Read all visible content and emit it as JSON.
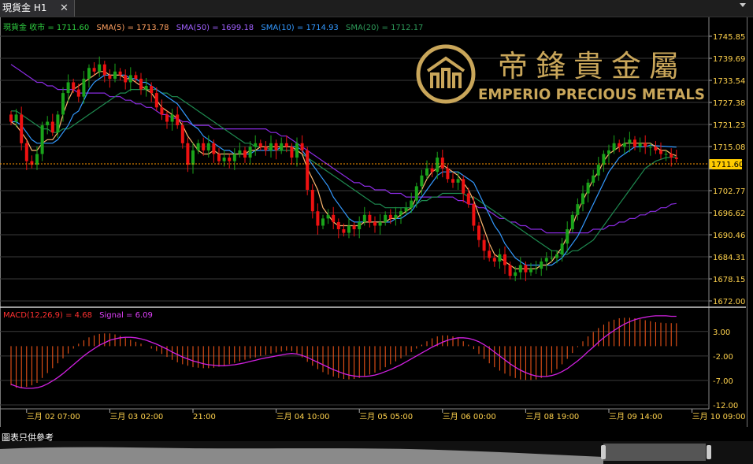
{
  "window": {
    "tab_title": "現貨金 H1",
    "close_glyph": "✕"
  },
  "legend": {
    "price": "現貨金 收市 = 1711.60",
    "sma5": "SMA(5) = 1713.78",
    "sma50": "SMA(50) = 1699.18",
    "sma10": "SMA(10) = 1714.93",
    "sma20": "SMA(20) = 1712.17"
  },
  "macd_legend": {
    "macd": "MACD(12,26,9) = 4.68",
    "signal": "Signal = 6.09"
  },
  "logo": {
    "chinese": "帝鋒貴金屬",
    "english": "EMPERIO PRECIOUS METALS"
  },
  "current_price_label": "1711.60",
  "footer_text": "圖表只供參考",
  "colors": {
    "up": "#1aa31a",
    "down": "#ee1111",
    "sma5": "#ffb870",
    "sma10": "#3399ff",
    "sma20": "#1e8a50",
    "sma50": "#8a2be2",
    "macd_hist": "#ff5a1a",
    "signal": "#d020e0",
    "gold": "#c9a65a",
    "axis_text": "#ffd24d",
    "grid": "#3a3a3a"
  },
  "chart_data": {
    "type": "candlestick",
    "instrument": "現貨金",
    "timeframe": "H1",
    "price_axis": {
      "ticks": [
        1745.85,
        1739.69,
        1733.54,
        1727.38,
        1721.23,
        1715.08,
        1708.92,
        1702.77,
        1696.62,
        1690.46,
        1684.31,
        1678.15,
        1672.0
      ],
      "tick_labels": [
        "1745.85",
        "1739.69",
        "1733.54",
        "1727.38",
        "1721.23",
        "1715.08",
        "",
        "1702.77",
        "1696.62",
        "1690.46",
        "1684.31",
        "1678.15",
        "1672.00"
      ],
      "ylim": [
        1672.0,
        1745.85
      ]
    },
    "macd_axis": {
      "ticks": [
        3.0,
        -2.0,
        -7.0,
        -12.0
      ],
      "tick_labels": [
        "3.00",
        "-2.00",
        "-7.00",
        "-12.00"
      ],
      "ylim": [
        -12.0,
        6.5
      ]
    },
    "x_ticks": [
      {
        "index": 3,
        "label": "三月 02 07:00"
      },
      {
        "index": 19,
        "label": "三月 03 02:00"
      },
      {
        "index": 35,
        "label": "21:00"
      },
      {
        "index": 51,
        "label": "三月 04 10:00"
      },
      {
        "index": 67,
        "label": "三月 05 05:00"
      },
      {
        "index": 83,
        "label": "三月 06 00:00"
      },
      {
        "index": 99,
        "label": "三月 08 19:00"
      },
      {
        "index": 115,
        "label": "三月 09 14:00"
      },
      {
        "index": 131,
        "label": "三月 10 09:00"
      }
    ],
    "current_price": 1711.6,
    "close": [
      1722,
      1724,
      1716,
      1711,
      1710,
      1713,
      1721,
      1722,
      1719,
      1724,
      1730,
      1733,
      1731,
      1729,
      1734,
      1737,
      1736,
      1738,
      1735,
      1734,
      1736,
      1735,
      1733,
      1735,
      1734,
      1731,
      1732,
      1730,
      1726,
      1724,
      1722,
      1724,
      1721,
      1716,
      1710,
      1714,
      1716,
      1714,
      1716,
      1713,
      1711,
      1712,
      1711,
      1713,
      1714,
      1712,
      1715,
      1716,
      1715,
      1714,
      1716,
      1714,
      1716,
      1715,
      1712,
      1716,
      1714,
      1703,
      1697,
      1693,
      1695,
      1696,
      1694,
      1692,
      1691,
      1693,
      1692,
      1694,
      1696,
      1694,
      1693,
      1694,
      1696,
      1695,
      1696,
      1697,
      1698,
      1700,
      1704,
      1707,
      1709,
      1708,
      1712,
      1709,
      1706,
      1705,
      1706,
      1702,
      1699,
      1693,
      1689,
      1686,
      1684,
      1683,
      1685,
      1682,
      1679,
      1680,
      1682,
      1680,
      1681,
      1681,
      1683,
      1684,
      1684,
      1685,
      1688,
      1692,
      1696,
      1699,
      1702,
      1705,
      1707,
      1710,
      1713,
      1714,
      1716,
      1715,
      1716,
      1717,
      1715,
      1716,
      1715,
      1715,
      1714,
      1713,
      1713,
      1712,
      1711.6
    ],
    "sma5": [
      1722,
      1721,
      1719,
      1717,
      1714,
      1714,
      1716,
      1717,
      1717,
      1719,
      1724,
      1728,
      1731,
      1732,
      1733,
      1734,
      1735,
      1736,
      1736,
      1735,
      1735,
      1735,
      1734,
      1734,
      1733,
      1732,
      1731,
      1730,
      1728,
      1726,
      1725,
      1724,
      1723,
      1721,
      1718,
      1716,
      1714,
      1713,
      1713,
      1714,
      1713,
      1713,
      1713,
      1713,
      1713,
      1713,
      1714,
      1714,
      1715,
      1715,
      1715,
      1715,
      1715,
      1715,
      1715,
      1714,
      1713,
      1709,
      1706,
      1703,
      1698,
      1696,
      1694,
      1693,
      1693,
      1693,
      1693,
      1693,
      1694,
      1694,
      1694,
      1694,
      1694,
      1695,
      1695,
      1696,
      1697,
      1698,
      1701,
      1703,
      1706,
      1708,
      1709,
      1710,
      1709,
      1708,
      1707,
      1705,
      1703,
      1700,
      1696,
      1692,
      1688,
      1685,
      1684,
      1683,
      1682,
      1681,
      1681,
      1681,
      1681,
      1681,
      1682,
      1682,
      1683,
      1685,
      1687,
      1690,
      1693,
      1697,
      1700,
      1703,
      1706,
      1708,
      1711,
      1713,
      1714,
      1715,
      1716,
      1716,
      1716,
      1716,
      1716,
      1716,
      1715,
      1714,
      1714,
      1713,
      1712.5
    ],
    "sma10": [
      1722,
      1722,
      1721,
      1719,
      1717,
      1716,
      1716,
      1716,
      1716,
      1717,
      1719,
      1721,
      1724,
      1725,
      1728,
      1731,
      1733,
      1734,
      1735,
      1735,
      1735,
      1735,
      1735,
      1734,
      1734,
      1733,
      1733,
      1732,
      1731,
      1730,
      1729,
      1728,
      1727,
      1725,
      1723,
      1721,
      1720,
      1718,
      1717,
      1716,
      1715,
      1714,
      1714,
      1713,
      1713,
      1713,
      1713,
      1714,
      1714,
      1714,
      1714,
      1714,
      1715,
      1715,
      1715,
      1715,
      1714,
      1712,
      1710,
      1708,
      1706,
      1704,
      1701,
      1699,
      1697,
      1695,
      1694,
      1694,
      1694,
      1694,
      1694,
      1694,
      1694,
      1694,
      1695,
      1695,
      1696,
      1697,
      1699,
      1701,
      1703,
      1705,
      1707,
      1708,
      1708,
      1708,
      1708,
      1707,
      1706,
      1705,
      1702,
      1699,
      1696,
      1693,
      1691,
      1688,
      1686,
      1684,
      1683,
      1682,
      1682,
      1682,
      1682,
      1682,
      1682,
      1683,
      1684,
      1686,
      1688,
      1690,
      1693,
      1696,
      1699,
      1702,
      1705,
      1708,
      1710,
      1712,
      1713,
      1714,
      1715,
      1715,
      1715,
      1715.5,
      1715.3,
      1715.2,
      1715.1,
      1715,
      1714.9
    ],
    "sma20": [
      1725,
      1725,
      1724,
      1723,
      1722,
      1721,
      1720,
      1720,
      1719,
      1719,
      1720,
      1720,
      1721,
      1722,
      1723,
      1724,
      1725,
      1726,
      1727,
      1728,
      1729,
      1730,
      1730,
      1731,
      1731,
      1731,
      1731,
      1731,
      1731,
      1730,
      1730,
      1729,
      1729,
      1728,
      1727,
      1726,
      1725,
      1724,
      1723,
      1722,
      1721,
      1720,
      1719,
      1718,
      1717,
      1716,
      1716,
      1715,
      1715,
      1715,
      1714,
      1714,
      1714,
      1714,
      1714,
      1714,
      1713,
      1712,
      1711,
      1710,
      1709,
      1708,
      1707,
      1706,
      1705,
      1704,
      1703,
      1702,
      1701,
      1700,
      1699,
      1699,
      1698,
      1698,
      1698,
      1698,
      1698,
      1698,
      1699,
      1700,
      1700,
      1701,
      1701,
      1702,
      1702,
      1702,
      1702,
      1702,
      1701,
      1701,
      1700,
      1699,
      1698,
      1697,
      1696,
      1695,
      1694,
      1693,
      1692,
      1691,
      1690,
      1689,
      1688,
      1687,
      1686,
      1686,
      1685,
      1685,
      1686,
      1686,
      1687,
      1688,
      1689,
      1691,
      1693,
      1695,
      1697,
      1699,
      1701,
      1703,
      1705,
      1707,
      1709,
      1710,
      1711,
      1711.5,
      1712,
      1712.1,
      1712.2
    ],
    "sma50": [
      1738,
      1737,
      1736,
      1735,
      1734,
      1733,
      1733,
      1732,
      1732,
      1731,
      1731,
      1731,
      1731,
      1730,
      1730,
      1730,
      1730,
      1730,
      1730,
      1729,
      1729,
      1729,
      1728,
      1728,
      1727,
      1727,
      1726,
      1726,
      1725,
      1724,
      1724,
      1723,
      1723,
      1722,
      1722,
      1721,
      1721,
      1721,
      1721,
      1720,
      1720,
      1720,
      1720,
      1720,
      1720,
      1720,
      1720,
      1720,
      1720,
      1720,
      1719,
      1719,
      1718,
      1718,
      1717,
      1716,
      1715,
      1714,
      1713,
      1712,
      1711,
      1710,
      1709,
      1708,
      1707,
      1706,
      1705,
      1705,
      1704,
      1704,
      1703,
      1703,
      1703,
      1702,
      1702,
      1702,
      1701,
      1701,
      1701,
      1701,
      1701,
      1701,
      1701,
      1701,
      1701,
      1701,
      1700,
      1700,
      1699,
      1699,
      1698,
      1698,
      1697,
      1696,
      1695,
      1695,
      1694,
      1694,
      1693,
      1693,
      1692,
      1692,
      1692,
      1691,
      1691,
      1691,
      1691,
      1691,
      1691,
      1691,
      1691,
      1691,
      1692,
      1692,
      1692,
      1693,
      1693,
      1694,
      1694,
      1695,
      1695,
      1696,
      1696,
      1697,
      1697,
      1698,
      1698,
      1699,
      1699.18
    ],
    "macd_hist": [
      -8,
      -8.5,
      -8.5,
      -8.3,
      -8,
      -7.5,
      -6.5,
      -5.5,
      -4.5,
      -3.5,
      -2.5,
      -1.5,
      -0.5,
      0.5,
      1.2,
      1.8,
      2.2,
      2.5,
      2.6,
      2.6,
      2.4,
      2.1,
      1.7,
      1.3,
      0.9,
      0.5,
      0,
      -0.5,
      -1,
      -1.6,
      -2.2,
      -2.8,
      -3.3,
      -3.7,
      -4,
      -4.3,
      -4.4,
      -4.5,
      -4.5,
      -4.4,
      -4.2,
      -4,
      -3.7,
      -3.4,
      -3.1,
      -2.8,
      -2.5,
      -2.3,
      -2,
      -1.8,
      -1.5,
      -1.3,
      -1.1,
      -0.9,
      -1,
      -1.5,
      -2.3,
      -3.2,
      -4,
      -4.7,
      -5.3,
      -5.8,
      -6.2,
      -6.5,
      -6.7,
      -6.8,
      -6.7,
      -6.5,
      -6.2,
      -5.8,
      -5.4,
      -4.9,
      -4.3,
      -3.7,
      -3.1,
      -2.5,
      -1.9,
      -1.2,
      -0.5,
      0.3,
      1,
      1.6,
      2,
      2.2,
      2.2,
      2,
      1.6,
      1,
      0.3,
      -0.6,
      -1.6,
      -2.6,
      -3.5,
      -4.3,
      -5,
      -5.6,
      -6.1,
      -6.5,
      -6.8,
      -6.9,
      -6.9,
      -6.8,
      -6.5,
      -6.1,
      -5.5,
      -4.7,
      -3.7,
      -2.6,
      -1.4,
      -0.2,
      1,
      2,
      2.9,
      3.7,
      4.4,
      5,
      5.4,
      5.7,
      5.8,
      5.8,
      5.7,
      5.5,
      5.3,
      5.1,
      4.9,
      4.8,
      4.7,
      4.7,
      4.68
    ],
    "signal": [
      -7.8,
      -8.2,
      -8.5,
      -8.6,
      -8.6,
      -8.5,
      -8.2,
      -7.7,
      -7.1,
      -6.4,
      -5.6,
      -4.7,
      -3.8,
      -2.9,
      -2,
      -1.2,
      -0.5,
      0.2,
      0.7,
      1.2,
      1.5,
      1.7,
      1.8,
      1.8,
      1.7,
      1.5,
      1.2,
      0.8,
      0.4,
      -0.1,
      -0.6,
      -1.2,
      -1.7,
      -2.2,
      -2.6,
      -3,
      -3.3,
      -3.6,
      -3.8,
      -3.9,
      -4,
      -4,
      -3.9,
      -3.8,
      -3.6,
      -3.4,
      -3.1,
      -2.9,
      -2.6,
      -2.4,
      -2.2,
      -2,
      -1.8,
      -1.6,
      -1.5,
      -1.6,
      -1.9,
      -2.3,
      -2.8,
      -3.3,
      -3.8,
      -4.3,
      -4.8,
      -5.2,
      -5.6,
      -5.9,
      -6.1,
      -6.2,
      -6.2,
      -6.1,
      -5.9,
      -5.6,
      -5.2,
      -4.8,
      -4.3,
      -3.8,
      -3.2,
      -2.6,
      -2,
      -1.4,
      -0.8,
      -0.2,
      0.3,
      0.8,
      1.2,
      1.5,
      1.7,
      1.7,
      1.6,
      1.3,
      0.9,
      0.3,
      -0.4,
      -1.2,
      -2,
      -2.8,
      -3.6,
      -4.3,
      -4.9,
      -5.4,
      -5.8,
      -6.1,
      -6.2,
      -6.2,
      -6,
      -5.7,
      -5.2,
      -4.6,
      -3.8,
      -3,
      -2.1,
      -1.1,
      -0.2,
      0.8,
      1.7,
      2.5,
      3.2,
      3.9,
      4.5,
      5,
      5.4,
      5.7,
      5.9,
      6.1,
      6.2,
      6.2,
      6.2,
      6.1,
      6.09
    ]
  }
}
